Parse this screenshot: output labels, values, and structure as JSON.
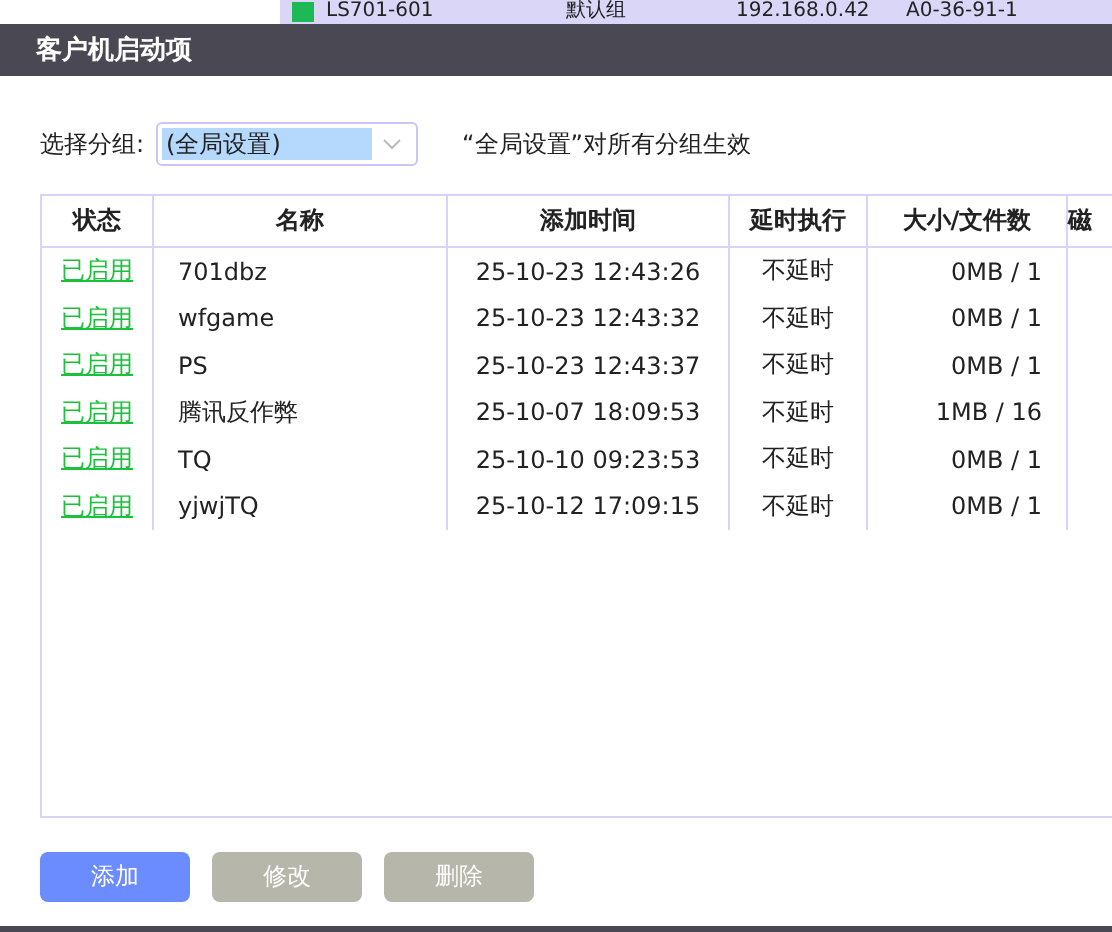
{
  "background_row": {
    "name": "LS701-601",
    "group": "默认组",
    "ip": "192.168.0.42",
    "mac": "A0-36-91-1"
  },
  "window": {
    "title": "客户机启动项"
  },
  "group_select": {
    "label": "选择分组:",
    "value": "(全局设置)",
    "hint": "“全局设置”对所有分组生效"
  },
  "table": {
    "columns": [
      "状态",
      "名称",
      "添加时间",
      "延时执行",
      "大小/文件数",
      "磁"
    ],
    "rows": [
      {
        "status": "已启用",
        "name": "701dbz",
        "added": "25-10-23 12:43:26",
        "delay": "不延时",
        "size": "0MB / 1"
      },
      {
        "status": "已启用",
        "name": "wfgame",
        "added": "25-10-23 12:43:32",
        "delay": "不延时",
        "size": "0MB / 1"
      },
      {
        "status": "已启用",
        "name": "PS",
        "added": "25-10-23 12:43:37",
        "delay": "不延时",
        "size": "0MB / 1"
      },
      {
        "status": "已启用",
        "name": "腾讯反作弊",
        "added": "25-10-07 18:09:53",
        "delay": "不延时",
        "size": "1MB / 16"
      },
      {
        "status": "已启用",
        "name": "TQ",
        "added": "25-10-10 09:23:53",
        "delay": "不延时",
        "size": "0MB / 1"
      },
      {
        "status": "已启用",
        "name": "yjwjTQ",
        "added": "25-10-12 17:09:15",
        "delay": "不延时",
        "size": "0MB / 1"
      }
    ]
  },
  "buttons": [
    {
      "label": "添加",
      "disabled": false
    },
    {
      "label": "修改",
      "disabled": true
    },
    {
      "label": "删除",
      "disabled": true
    }
  ]
}
